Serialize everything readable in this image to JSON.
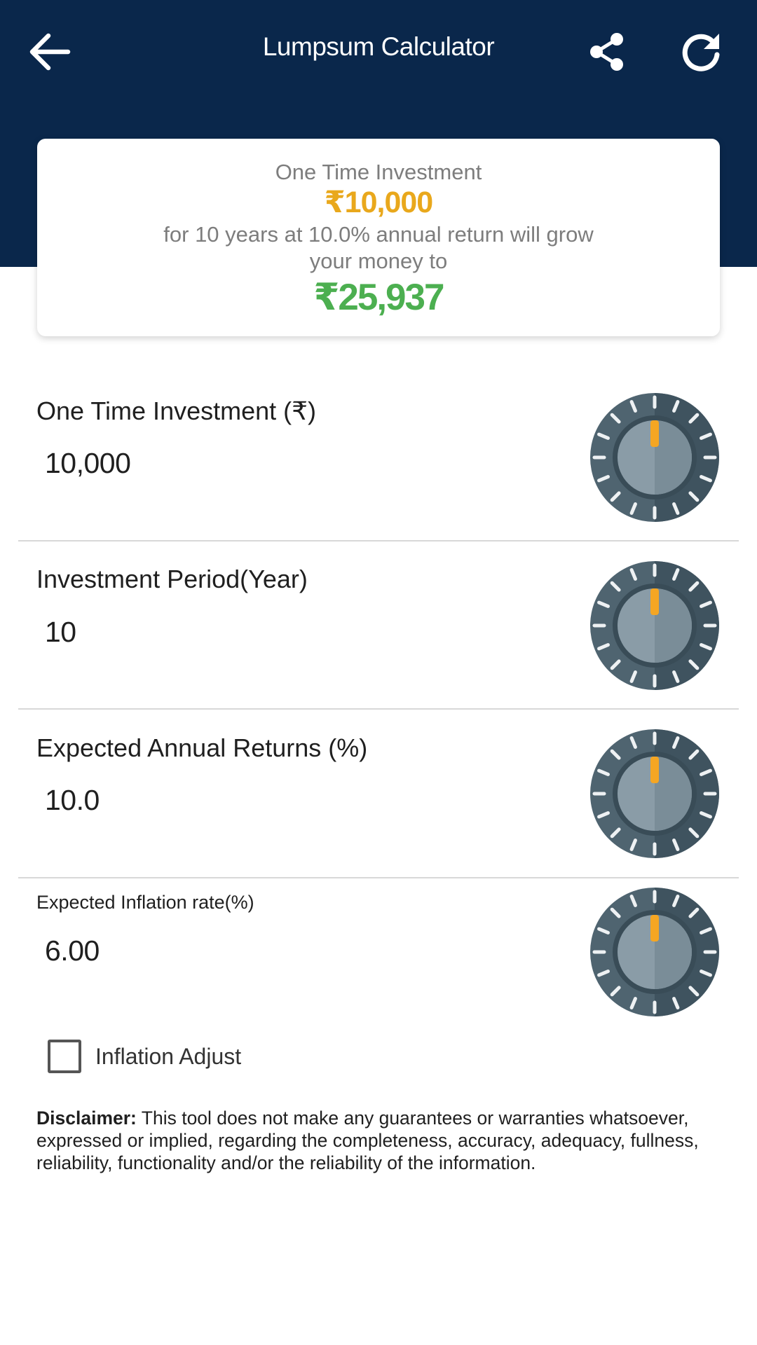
{
  "appbar": {
    "title": "Lumpsum Calculator",
    "back_icon": "arrow-left-icon",
    "share_icon": "share-icon",
    "refresh_icon": "refresh-icon"
  },
  "summary": {
    "label": "One Time Investment",
    "investment": "₹10,000",
    "description": "for 10 years at 10.0% annual return will grow your money to",
    "result": "₹25,937"
  },
  "fields": [
    {
      "label": "One Time Investment (₹)",
      "value": "10,000"
    },
    {
      "label": "Investment Period(Year)",
      "value": "10"
    },
    {
      "label": "Expected Annual Returns (%)",
      "value": "10.0"
    },
    {
      "label": "Expected Inflation rate(%)",
      "value": "6.00"
    }
  ],
  "inflation_adjust": {
    "label": "Inflation Adjust",
    "checked": false
  },
  "disclaimer": {
    "title": "Disclaimer:",
    "text": "This tool does not make any guarantees or warranties whatsoever, expressed or implied, regarding the completeness, accuracy, adequacy, fullness, reliability, functionality and/or the reliability of the information."
  },
  "colors": {
    "header_bg": "#0a274b",
    "investment_amount": "#e9a81c",
    "result_amount": "#4caf50",
    "dial_indicator": "#f5a623"
  }
}
